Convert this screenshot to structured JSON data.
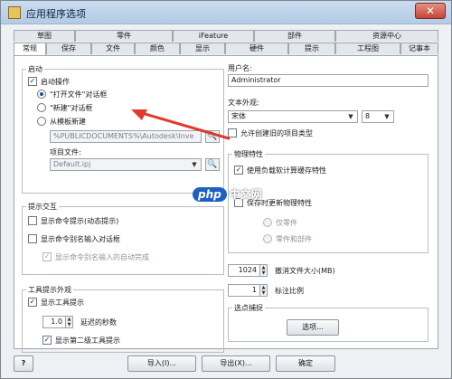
{
  "window": {
    "title": "应用程序选项",
    "close_symbol": "✕"
  },
  "tabs": {
    "row1": [
      "草图",
      "零件",
      "iFeature",
      "部件",
      "资源中心"
    ],
    "row2": [
      "常规",
      "保存",
      "文件",
      "颜色",
      "显示",
      "硬件",
      "提示",
      "工程图",
      "记事本"
    ]
  },
  "startup": {
    "title": "启动",
    "enable": "启动操作",
    "opt_open": "\"打开文件\"对话框",
    "opt_new": "\"新建\"对话框",
    "opt_template": "从模板新建",
    "path": "%PUBLICDOCUMENTS%\\Autodesk\\Inve",
    "project_label": "项目文件:",
    "project_file": "Default.ipj"
  },
  "prompt": {
    "title": "提示交互",
    "show_cmd": "显示命令提示(动态提示)",
    "show_alias": "显示命令别名输入对话框",
    "autocomplete": "显示命令别名输入的自动完成"
  },
  "tooltip": {
    "title": "工具提示外观",
    "show": "显示工具提示",
    "delay_value": "1.0",
    "delay_label": "延迟的秒数",
    "show_second": "显示第二级工具提示"
  },
  "right": {
    "username_label": "用户名:",
    "username": "Administrator",
    "text_label": "文本外观:",
    "font": "宋体",
    "font_size": "8",
    "allow_create": "允许创建旧的项目类型"
  },
  "physical": {
    "title": "物理特性",
    "use_cached": "使用负载软计算缓存特性",
    "update_on_save": "保存时更新物理特性",
    "opt_part": "仅零件",
    "opt_part_asm": "零件和部件"
  },
  "undo": {
    "value": "1024",
    "label": "撤消文件大小(MB)"
  },
  "annotation": {
    "value": "1",
    "label": "标注比例"
  },
  "selection": {
    "title": "选点捕捉",
    "options_label": "选项..."
  },
  "footer": {
    "help_symbol": "?",
    "import_label": "导入(I)...",
    "export_label": "导出(X)...",
    "ok_label": "确定"
  },
  "watermark": {
    "badge": "php",
    "text": "中文网"
  }
}
